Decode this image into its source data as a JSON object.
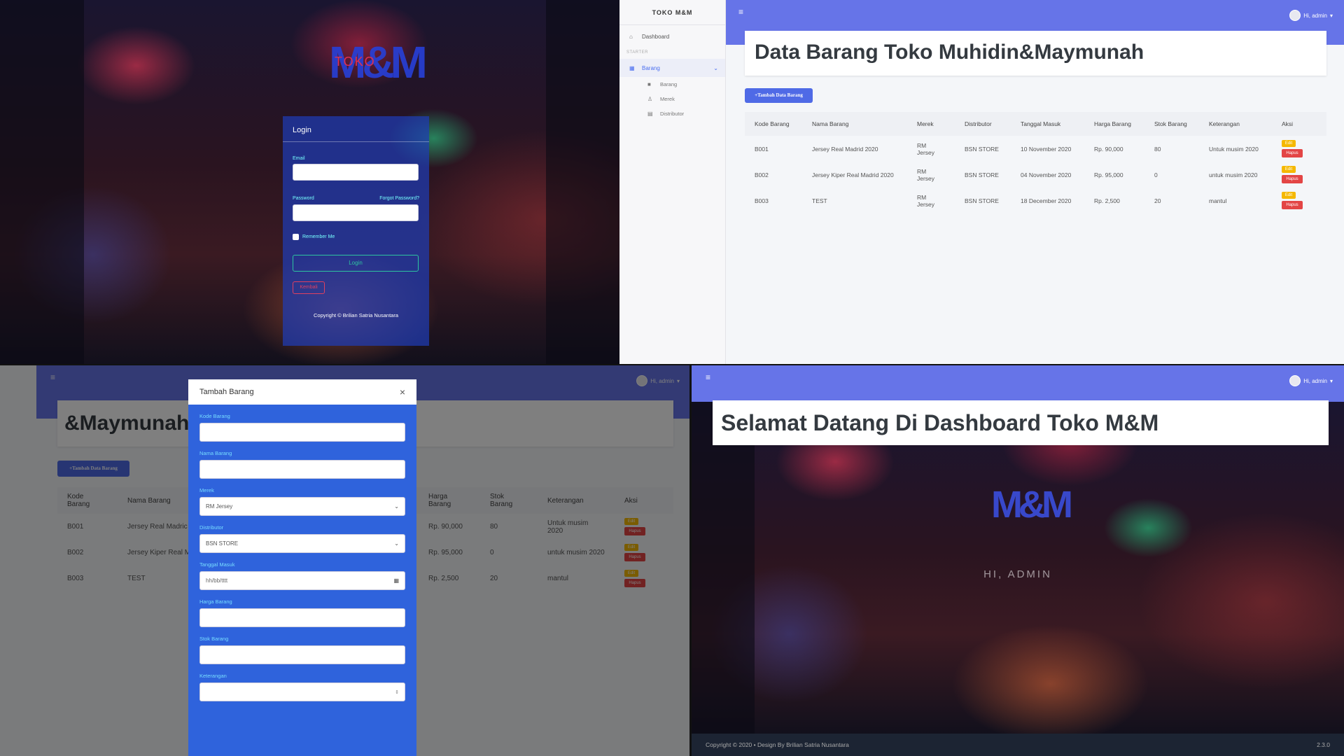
{
  "login": {
    "logo_mark": "M&M",
    "logo_text": "TOKO",
    "title": "Login",
    "email_label": "Email",
    "password_label": "Password",
    "forgot_label": "Forgot Password?",
    "remember_label": "Remember Me",
    "login_button": "Login",
    "back_button": "Kembali",
    "copyright": "Copyright © Brilian Satria Nusantara"
  },
  "admin": {
    "brand": "TOKO M&M",
    "nav": {
      "dashboard": "Dashboard",
      "header": "STARTER",
      "barang_group": "Barang",
      "sub_barang": "Barang",
      "sub_merek": "Merek",
      "sub_distributor": "Distributor"
    },
    "user_label": "Hi, admin",
    "title": "Data Barang Toko Muhidin&Maymunah",
    "add_button": "+Tambah Data Barang",
    "columns": [
      "Kode Barang",
      "Nama Barang",
      "Merek",
      "Distributor",
      "Tanggal Masuk",
      "Harga Barang",
      "Stok Barang",
      "Keterangan",
      "Aksi"
    ],
    "rows": [
      {
        "kode": "B001",
        "nama": "Jersey Real Madrid 2020",
        "merek": "RM Jersey",
        "distributor": "BSN STORE",
        "tanggal": "10 November 2020",
        "harga": "Rp. 90,000",
        "stok": "80",
        "ket": "Untuk musim 2020"
      },
      {
        "kode": "B002",
        "nama": "Jersey Kiper Real Madrid 2020",
        "merek": "RM Jersey",
        "distributor": "BSN STORE",
        "tanggal": "04 November 2020",
        "harga": "Rp. 95,000",
        "stok": "0",
        "ket": "untuk musim 2020"
      },
      {
        "kode": "B003",
        "nama": "TEST",
        "merek": "RM Jersey",
        "distributor": "BSN STORE",
        "tanggal": "18 December 2020",
        "harga": "Rp. 2,500",
        "stok": "20",
        "ket": "mantul"
      }
    ],
    "edit_label": "Edit",
    "delete_label": "Hapus"
  },
  "modal": {
    "behind_title": "&Maymunah",
    "behind_columns": [
      "Kode Barang",
      "Nama Barang",
      "Harga Barang",
      "Stok Barang",
      "Keterangan",
      "Aksi"
    ],
    "behind_names": [
      "Jersey Real Madric",
      "Jersey Kiper Real M 2020",
      "TEST"
    ],
    "title": "Tambah Barang",
    "close": "×",
    "fields": {
      "kode": "Kode Barang",
      "nama": "Nama Barang",
      "merek": "Merek",
      "merek_value": "RM Jersey",
      "distributor": "Distributor",
      "distributor_value": "BSN STORE",
      "tanggal": "Tanggal Masuk",
      "tanggal_placeholder": "hh/bb/tttt",
      "harga": "Harga Barang",
      "stok": "Stok Barang",
      "keterangan": "Keterangan"
    }
  },
  "dashboard": {
    "user_label": "Hi, admin",
    "title": "Selamat Datang Di Dashboard Toko M&M",
    "greeting": "HI, ADMIN",
    "logo_mark": "M&M",
    "footer_left": "Copyright © 2020 • Design By Brilian Satria Nusantara",
    "footer_right": "2.3.0"
  },
  "colors": {
    "topbar": "#6674e8",
    "modal": "#2f63dc",
    "edit": "#f5b800",
    "delete": "#e34545"
  }
}
